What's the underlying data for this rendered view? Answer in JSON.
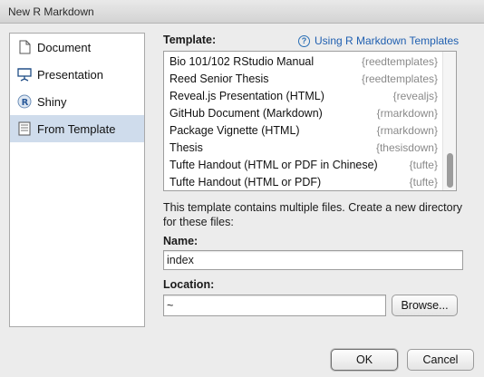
{
  "window": {
    "title": "New R Markdown"
  },
  "sidebar": {
    "items": [
      {
        "label": "Document",
        "icon": "document-icon"
      },
      {
        "label": "Presentation",
        "icon": "presentation-icon"
      },
      {
        "label": "Shiny",
        "icon": "shiny-r-icon"
      },
      {
        "label": "From Template",
        "icon": "template-icon",
        "selected": true
      }
    ]
  },
  "template_section": {
    "label": "Template:",
    "help_link": "Using R Markdown Templates",
    "items": [
      {
        "name": "Bio 101/102 RStudio Manual",
        "package": "{reedtemplates}"
      },
      {
        "name": "Reed Senior Thesis",
        "package": "{reedtemplates}"
      },
      {
        "name": "Reveal.js Presentation (HTML)",
        "package": "{revealjs}"
      },
      {
        "name": "GitHub Document (Markdown)",
        "package": "{rmarkdown}"
      },
      {
        "name": "Package Vignette (HTML)",
        "package": "{rmarkdown}"
      },
      {
        "name": "Thesis",
        "package": "{thesisdown}"
      },
      {
        "name": "Tufte Handout (HTML or PDF in Chinese)",
        "package": "{tufte}"
      },
      {
        "name": "Tufte Handout (HTML or PDF)",
        "package": "{tufte}"
      }
    ]
  },
  "description": "This template contains multiple files. Create a new directory for these files:",
  "name_field": {
    "label": "Name:",
    "value": "index"
  },
  "location_field": {
    "label": "Location:",
    "value": "~"
  },
  "buttons": {
    "browse": "Browse...",
    "ok": "OK",
    "cancel": "Cancel"
  }
}
